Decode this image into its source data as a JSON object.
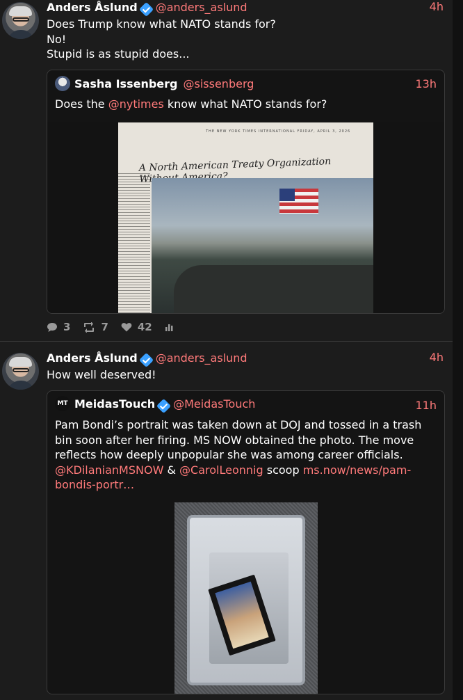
{
  "posts": [
    {
      "author": "Anders Åslund",
      "handle": "@anders_aslund",
      "time": "4h",
      "lines": [
        "Does Trump know what NATO stands for?",
        "No!",
        "Stupid is as stupid does..."
      ],
      "quote": {
        "author": "Sasha Issenberg",
        "handle": "@sissenberg",
        "time": "13h",
        "text_before": "Does the ",
        "mention": "@nytimes",
        "text_after": " know what NATO stands for?",
        "image": {
          "masthead": "THE NEW YORK TIMES INTERNATIONAL FRIDAY, APRIL 3, 2026",
          "headline": "A North American Treaty Organization Without America?"
        }
      },
      "actions": {
        "replies": "3",
        "reposts": "7",
        "likes": "42"
      }
    },
    {
      "author": "Anders Åslund",
      "handle": "@anders_aslund",
      "time": "4h",
      "lines": [
        "How well deserved!"
      ],
      "quote": {
        "author": "MeidasTouch",
        "handle": "@MeidasTouch",
        "time": "11h",
        "avatar_text": "MT",
        "text_main": "Pam Bondi’s portrait was taken down at DOJ and tossed in a trash bin soon after her firing. MS NOW obtained the photo. The move reflects how deeply unpopular she was among career officials.",
        "mention1": "@KDilanianMSNOW",
        "amp": " & ",
        "mention2": "@CarolLeonnig",
        "scoop": " scoop ",
        "link": "ms.now/news/pam-bondis-portr…"
      }
    }
  ],
  "colors": {
    "accent": "#ff7a7a",
    "background": "#1c1c1c",
    "verified": "#3aa0ff"
  }
}
